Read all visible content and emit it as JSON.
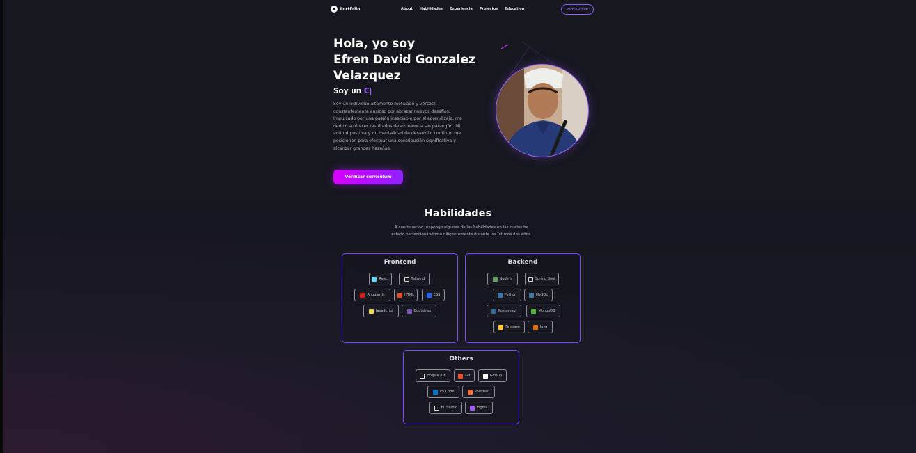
{
  "nav": {
    "logo": "Portfolio",
    "links": [
      "About",
      "Habilidades",
      "Experiencia",
      "Projectos",
      "Education"
    ],
    "github_button": "Perfil Github"
  },
  "hero": {
    "greeting_line1": "Hola, yo soy",
    "name_line1": "Efren David Gonzalez",
    "name_line2": "Velazquez",
    "role_prefix": "Soy un",
    "role_typed": "C|",
    "description": "Soy un individuo altamente motivado y versátil, constantemente ansioso por abrazar nuevos desafíos. Impulsado por una pasión insaciable por el aprendizaje, me dedico a ofrecer resultados de excelencia sin parangón. Mi actitud positiva y mi mentalidad de desarrollo continuo me posicionan para efectuar una contribución significativa y alcanzar grandes hazañas.",
    "cta": "Verificar curriculum",
    "avatar": "profile-photo"
  },
  "skills": {
    "title": "Habilidades",
    "description": "A continuación, expongo algunas de las habilidades en las cuales he estado perfeccionándome diligentemente durante los últimos dos años.",
    "cards": [
      {
        "title": "Frontend",
        "items": [
          {
            "label": "React",
            "icon": "react-icon",
            "color": "#61dafb"
          },
          {
            "label": "Tailwind",
            "icon": "tailwind-icon",
            "color": "box"
          },
          {
            "label": "Angular Js",
            "icon": "angular-icon",
            "color": "#dd1b16"
          },
          {
            "label": "HTML",
            "icon": "html-icon",
            "color": "#e44d26"
          },
          {
            "label": "CSS",
            "icon": "css-icon",
            "color": "#2965f1"
          },
          {
            "label": "JavaScript",
            "icon": "javascript-icon",
            "color": "#f0db4f"
          },
          {
            "label": "Bootstrap",
            "icon": "bootstrap-icon",
            "color": "#7952b3"
          }
        ]
      },
      {
        "title": "Backend",
        "items": [
          {
            "label": "Node Js",
            "icon": "nodejs-icon",
            "color": "#68a063"
          },
          {
            "label": "Spring Boot",
            "icon": "spring-boot-icon",
            "color": "box"
          },
          {
            "label": "Python",
            "icon": "python-icon",
            "color": "#3776ab"
          },
          {
            "label": "MySQL",
            "icon": "mysql-icon",
            "color": "#4479a1"
          },
          {
            "label": "Postgresql",
            "icon": "postgresql-icon",
            "color": "#336791"
          },
          {
            "label": "MongoDB",
            "icon": "mongodb-icon",
            "color": "#4db33d"
          },
          {
            "label": "Firebase",
            "icon": "firebase-icon",
            "color": "#ffca28"
          },
          {
            "label": "Java",
            "icon": "java-icon",
            "color": "#e76f00"
          }
        ]
      },
      {
        "title": "Others",
        "items": [
          {
            "label": "Eclipse IDE",
            "icon": "eclipse-icon",
            "color": "box"
          },
          {
            "label": "Git",
            "icon": "git-icon",
            "color": "#f05032"
          },
          {
            "label": "GitHub",
            "icon": "github-icon",
            "color": "#ffffff"
          },
          {
            "label": "VS Code",
            "icon": "vscode-icon",
            "color": "#007acc"
          },
          {
            "label": "Postman",
            "icon": "postman-icon",
            "color": "#ff6c37"
          },
          {
            "label": "FL Studio",
            "icon": "fl-studio-icon",
            "color": "box"
          },
          {
            "label": "Figma",
            "icon": "figma-icon",
            "color": "#a259ff"
          }
        ]
      }
    ]
  }
}
